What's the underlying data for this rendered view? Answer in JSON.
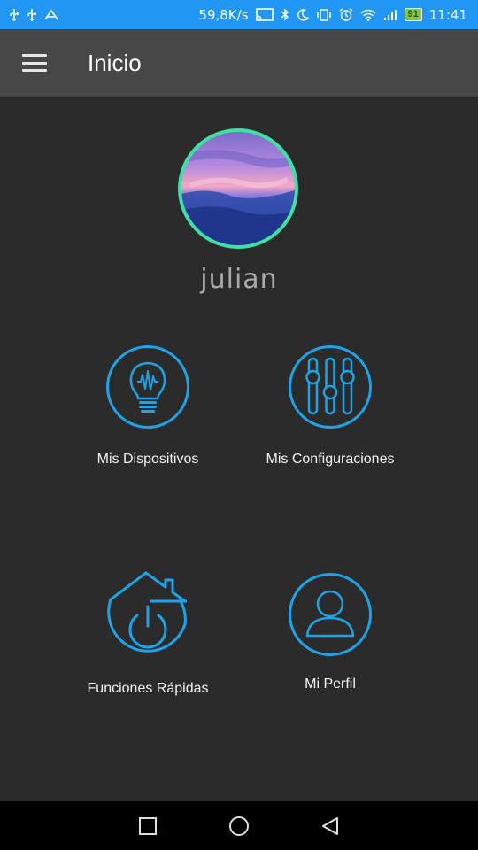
{
  "status_bar": {
    "network_speed": "59,8K/s",
    "battery": "91",
    "time": "11:41"
  },
  "app_bar": {
    "title": "Inicio"
  },
  "profile": {
    "username": "julian"
  },
  "menu": [
    {
      "label": "Mis Dispositivos",
      "icon": "lightbulb-icon"
    },
    {
      "label": "Mis Configuraciones",
      "icon": "sliders-icon"
    },
    {
      "label": "Funciones Rápidas",
      "icon": "home-power-icon"
    },
    {
      "label": "Mi Perfil",
      "icon": "user-icon"
    }
  ],
  "colors": {
    "status_bar": "#2196f3",
    "app_bar": "#474747",
    "background": "#2b2b2b",
    "accent": "#1fa3e8",
    "avatar_ring": "#3ee0a4"
  }
}
